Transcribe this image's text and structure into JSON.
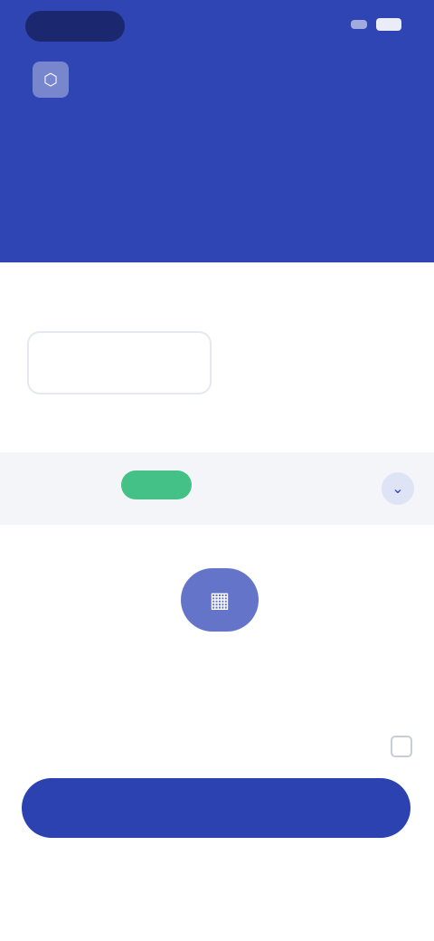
{
  "status_bar": {
    "icons": [
      "signal-icon",
      "battery-icon"
    ]
  },
  "top_bar": {
    "logo_icon": "logo-icon",
    "title": "",
    "action_label": ""
  },
  "hero": {
    "title": "",
    "subtitle": "",
    "color": "#2f45b3"
  },
  "form": {
    "section_label": "",
    "field_placeholder": "",
    "field_side_text": "",
    "plan_section_label": ""
  },
  "plan": {
    "name": "",
    "badge": "",
    "description": "",
    "chevron_icon": "chevron-down-icon",
    "badge_color": "#43c187"
  },
  "scan": {
    "icon": "scan-icon",
    "label": ""
  },
  "terms": {
    "text": ""
  },
  "cta": {
    "label": ""
  },
  "footer": {
    "line": "",
    "links": [
      "",
      "",
      ""
    ]
  }
}
